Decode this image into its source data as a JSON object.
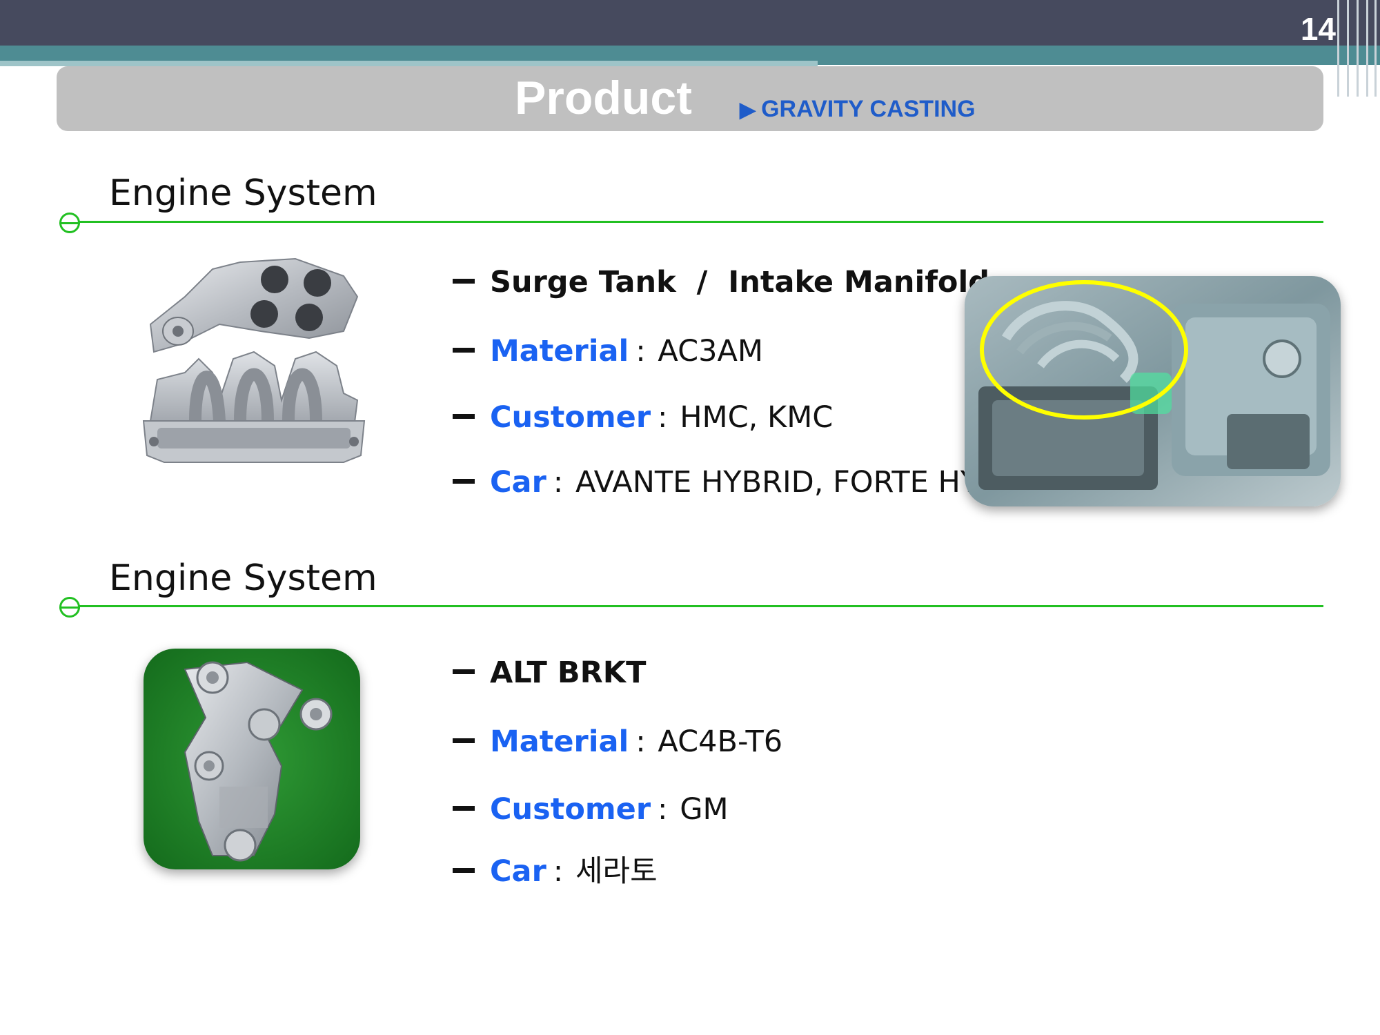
{
  "page": {
    "number": "14",
    "title": "Product",
    "subtitle": "GRAVITY CASTING"
  },
  "sections": [
    {
      "heading": "Engine System",
      "product": "Surge Tank  /  Intake Manifold",
      "material_label": "Material",
      "material": "AC3AM",
      "customer_label": "Customer",
      "customer": "HMC, KMC",
      "car_label": "Car",
      "car": "AVANTE HYBRID, FORTE HYBRID"
    },
    {
      "heading": "Engine System",
      "product": "ALT BRKT",
      "material_label": "Material",
      "material": "AC4B-T6",
      "customer_label": "Customer",
      "customer": "GM",
      "car_label": "Car",
      "car": "세라토"
    }
  ],
  "colors": {
    "header_bar": "#464a5e",
    "teal_band": "#4e8c93",
    "banner": "#c0c0c0",
    "subtitle_blue": "#1f5cc9",
    "key_blue": "#1a62f2",
    "section_green": "#22c022",
    "highlight_yellow": "#ffff00"
  },
  "icons": {
    "subtitle_marker": "play-triangle-icon",
    "section_marker": "circle-line-icon",
    "bullet_marker": "dash-icon"
  }
}
